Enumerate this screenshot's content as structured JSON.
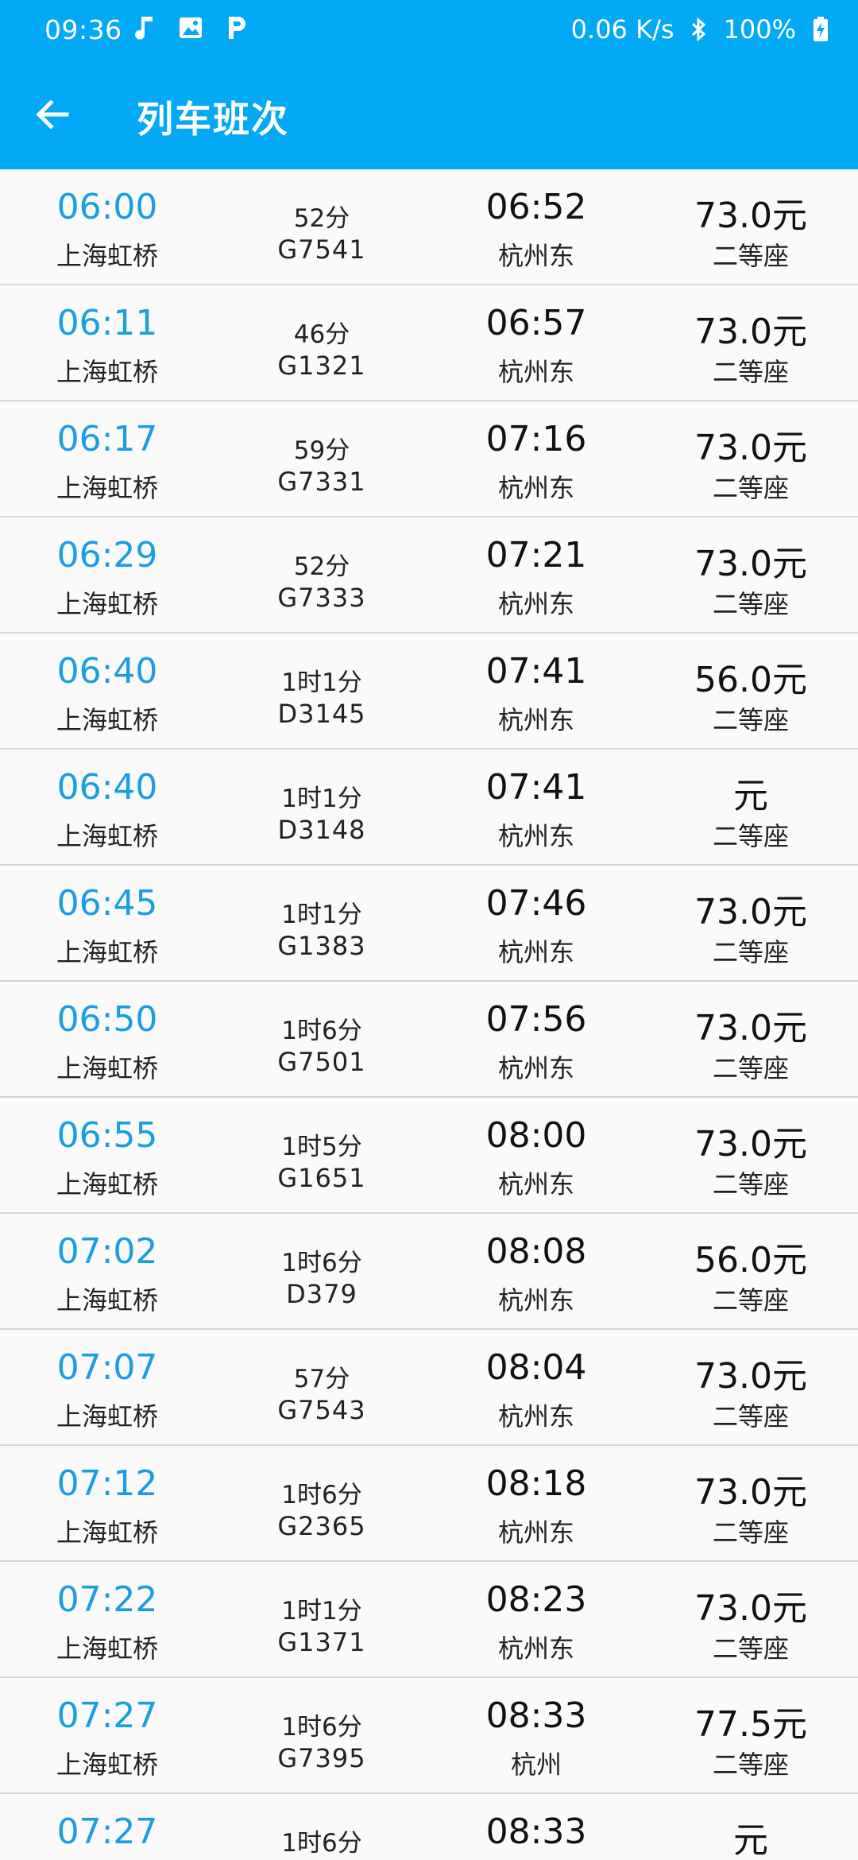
{
  "status_bar": {
    "time": "09:36",
    "speed": "0.06 K/s",
    "battery": "100%",
    "icons": [
      "music-note-icon",
      "image-icon",
      "parking-p-icon",
      "bluetooth-icon",
      "battery-charging-icon"
    ]
  },
  "toolbar": {
    "title": "列车班次",
    "back_icon": "arrow-left-icon"
  },
  "colors": {
    "primary": "#03A9F4",
    "departure_time": "#1a9ee0",
    "divider": "#d6d6d6",
    "background": "#fafafa"
  },
  "trains": [
    {
      "dep_time": "06:00",
      "dep_station": "上海虹桥",
      "duration": "52分",
      "train_no": "G7541",
      "arr_time": "06:52",
      "arr_station": "杭州东",
      "price": "73.0元",
      "seat": "二等座"
    },
    {
      "dep_time": "06:11",
      "dep_station": "上海虹桥",
      "duration": "46分",
      "train_no": "G1321",
      "arr_time": "06:57",
      "arr_station": "杭州东",
      "price": "73.0元",
      "seat": "二等座"
    },
    {
      "dep_time": "06:17",
      "dep_station": "上海虹桥",
      "duration": "59分",
      "train_no": "G7331",
      "arr_time": "07:16",
      "arr_station": "杭州东",
      "price": "73.0元",
      "seat": "二等座"
    },
    {
      "dep_time": "06:29",
      "dep_station": "上海虹桥",
      "duration": "52分",
      "train_no": "G7333",
      "arr_time": "07:21",
      "arr_station": "杭州东",
      "price": "73.0元",
      "seat": "二等座"
    },
    {
      "dep_time": "06:40",
      "dep_station": "上海虹桥",
      "duration": "1时1分",
      "train_no": "D3145",
      "arr_time": "07:41",
      "arr_station": "杭州东",
      "price": "56.0元",
      "seat": "二等座"
    },
    {
      "dep_time": "06:40",
      "dep_station": "上海虹桥",
      "duration": "1时1分",
      "train_no": "D3148",
      "arr_time": "07:41",
      "arr_station": "杭州东",
      "price": "元",
      "seat": "二等座"
    },
    {
      "dep_time": "06:45",
      "dep_station": "上海虹桥",
      "duration": "1时1分",
      "train_no": "G1383",
      "arr_time": "07:46",
      "arr_station": "杭州东",
      "price": "73.0元",
      "seat": "二等座"
    },
    {
      "dep_time": "06:50",
      "dep_station": "上海虹桥",
      "duration": "1时6分",
      "train_no": "G7501",
      "arr_time": "07:56",
      "arr_station": "杭州东",
      "price": "73.0元",
      "seat": "二等座"
    },
    {
      "dep_time": "06:55",
      "dep_station": "上海虹桥",
      "duration": "1时5分",
      "train_no": "G1651",
      "arr_time": "08:00",
      "arr_station": "杭州东",
      "price": "73.0元",
      "seat": "二等座"
    },
    {
      "dep_time": "07:02",
      "dep_station": "上海虹桥",
      "duration": "1时6分",
      "train_no": "D379",
      "arr_time": "08:08",
      "arr_station": "杭州东",
      "price": "56.0元",
      "seat": "二等座"
    },
    {
      "dep_time": "07:07",
      "dep_station": "上海虹桥",
      "duration": "57分",
      "train_no": "G7543",
      "arr_time": "08:04",
      "arr_station": "杭州东",
      "price": "73.0元",
      "seat": "二等座"
    },
    {
      "dep_time": "07:12",
      "dep_station": "上海虹桥",
      "duration": "1时6分",
      "train_no": "G2365",
      "arr_time": "08:18",
      "arr_station": "杭州东",
      "price": "73.0元",
      "seat": "二等座"
    },
    {
      "dep_time": "07:22",
      "dep_station": "上海虹桥",
      "duration": "1时1分",
      "train_no": "G1371",
      "arr_time": "08:23",
      "arr_station": "杭州东",
      "price": "73.0元",
      "seat": "二等座"
    },
    {
      "dep_time": "07:27",
      "dep_station": "上海虹桥",
      "duration": "1时6分",
      "train_no": "G7395",
      "arr_time": "08:33",
      "arr_station": "杭州",
      "price": "77.5元",
      "seat": "二等座"
    },
    {
      "dep_time": "07:27",
      "dep_station": "",
      "duration": "1时6分",
      "train_no": "",
      "arr_time": "08:33",
      "arr_station": "",
      "price": "元",
      "seat": ""
    }
  ]
}
